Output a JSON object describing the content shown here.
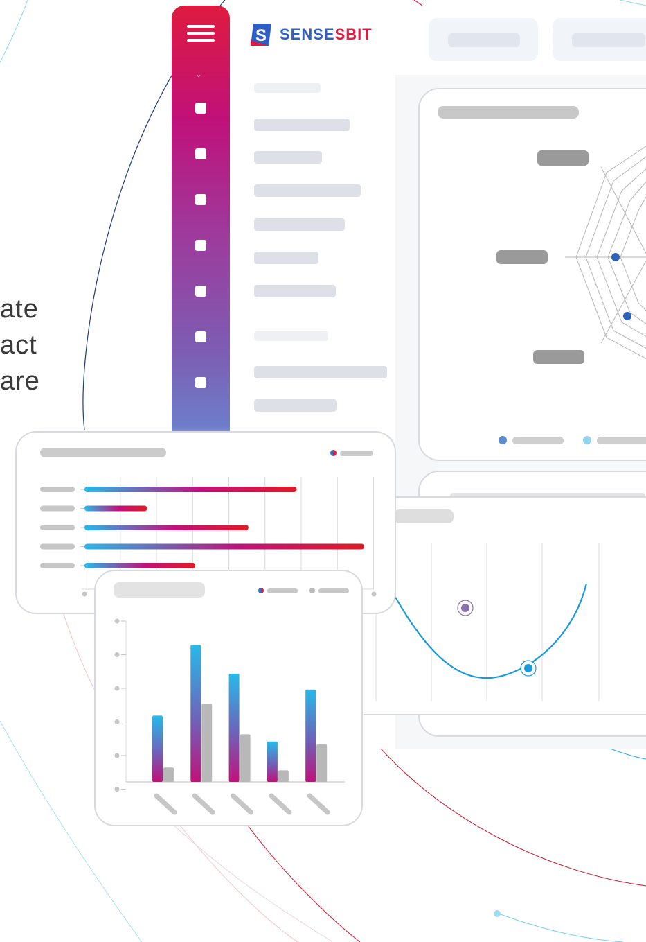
{
  "hero": {
    "lines": [
      "ate",
      "act",
      "are"
    ]
  },
  "brand": {
    "name_part1": "SENSE",
    "name_part2": "SBIT",
    "logo_letter": "S",
    "primary": "#2f5fc4",
    "accent": "#e01b3f"
  },
  "sidebar": {
    "gradient_top": "#de1b3f",
    "gradient_bottom": "#6d7dc9",
    "icons": [
      "menu-icon",
      "chevron-down-icon"
    ],
    "nav_item_count": 7
  },
  "colors": {
    "cyan": "#27b9ea",
    "magenta": "#c0117a",
    "red": "#e01b24",
    "gray": "#b8b8b8",
    "curve": "#1a9ad9",
    "radar_dot": "#2c63b8"
  },
  "chart_data": [
    {
      "type": "bar",
      "orientation": "horizontal",
      "values": [
        44,
        13,
        34,
        58,
        23
      ]
    },
    {
      "type": "bar",
      "orientation": "vertical",
      "series": [
        {
          "values": [
            46,
            95,
            75,
            28,
            64
          ]
        },
        {
          "values": [
            10,
            54,
            33,
            8,
            26
          ]
        }
      ]
    }
  ]
}
